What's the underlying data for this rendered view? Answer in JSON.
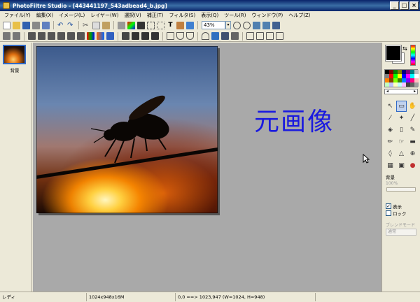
{
  "window": {
    "title": "PhotoFiltre Studio - [443441197_543adbead4_b.jpg]"
  },
  "menu": [
    "ファイル(Y)",
    "編集(X)",
    "イメージ(L)",
    "レイヤー(W)",
    "選択(V)",
    "補正(T)",
    "フィルタ(S)",
    "表示(Q)",
    "ツール(R)",
    "ウィンドウ(P)",
    "ヘルプ(Z)"
  ],
  "toolbar": {
    "zoom_value": "43%"
  },
  "thumbnail": {
    "label": "背景"
  },
  "workspace": {
    "overlay_text": "元画像"
  },
  "layers": {
    "title": "背景",
    "opacity_label": "100%",
    "visible_label": "表示",
    "visible_checked": "✓",
    "lock_label": "ロック",
    "blend_label": "ブレンドモード",
    "blend_value": "通常"
  },
  "status": {
    "ready": "レディ",
    "size_info": "1024x948x16M",
    "coords": "0,0 ==> 1023,947 (W=1024, H=948)"
  },
  "colors": {
    "foreground": "#000000",
    "background": "#ffffff",
    "title_bar": "#0a246a",
    "overlay_text": "#1a1adf"
  }
}
